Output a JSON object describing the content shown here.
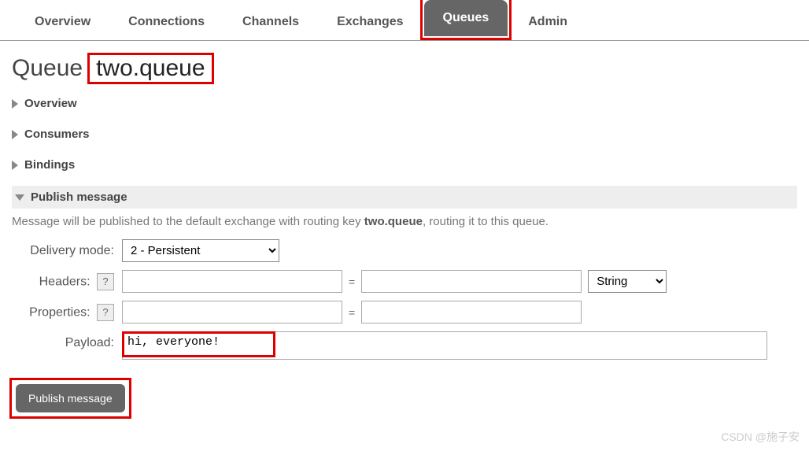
{
  "tabs": {
    "overview": "Overview",
    "connections": "Connections",
    "channels": "Channels",
    "exchanges": "Exchanges",
    "queues": "Queues",
    "admin": "Admin"
  },
  "page_title_prefix": "Queue",
  "queue_name": "two.queue",
  "sections": {
    "overview": "Overview",
    "consumers": "Consumers",
    "bindings": "Bindings",
    "publish": "Publish message"
  },
  "publish": {
    "desc_before": "Message will be published to the default exchange with routing key ",
    "desc_key": "two.queue",
    "desc_after": ", routing it to this queue.",
    "delivery_mode_label": "Delivery mode:",
    "delivery_mode_value": "2 - Persistent",
    "headers_label": "Headers:",
    "help_symbol": "?",
    "eq": "=",
    "properties_label": "Properties:",
    "payload_label": "Payload:",
    "payload_value": "hi, everyone!",
    "type_value": "String",
    "button": "Publish message"
  },
  "watermark": "CSDN @施子安"
}
